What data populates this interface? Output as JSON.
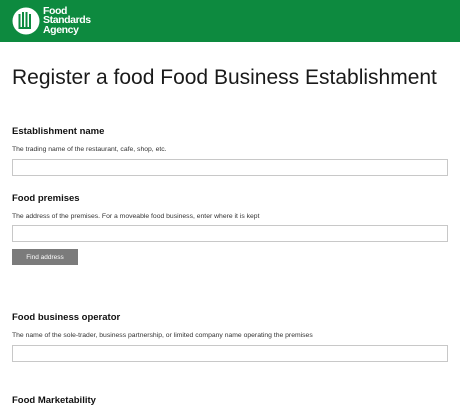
{
  "header": {
    "logo_lines": [
      "Food",
      "Standards",
      "Agency"
    ],
    "background": "#0d8a3f",
    "icon": "fsa-logo-icon"
  },
  "page": {
    "title": "Register a food Food Business Establishment"
  },
  "fields": {
    "establishment_name": {
      "label": "Establishment name",
      "hint": "The trading name of the restaurant, cafe, shop, etc.",
      "value": ""
    },
    "food_premises": {
      "label": "Food premises",
      "hint": "The address of the premises. For a moveable food business, enter where it is kept",
      "value": "",
      "button_label": "Find address"
    },
    "food_business_operator": {
      "label": "Food business operator",
      "hint": "The name of the sole-trader, business partnership, or limited company name operating the premises",
      "value": ""
    },
    "next_section": {
      "label": "Food Marketability"
    }
  },
  "colors": {
    "button": "#7b7b7b",
    "input_border": "#c8c8c8"
  }
}
